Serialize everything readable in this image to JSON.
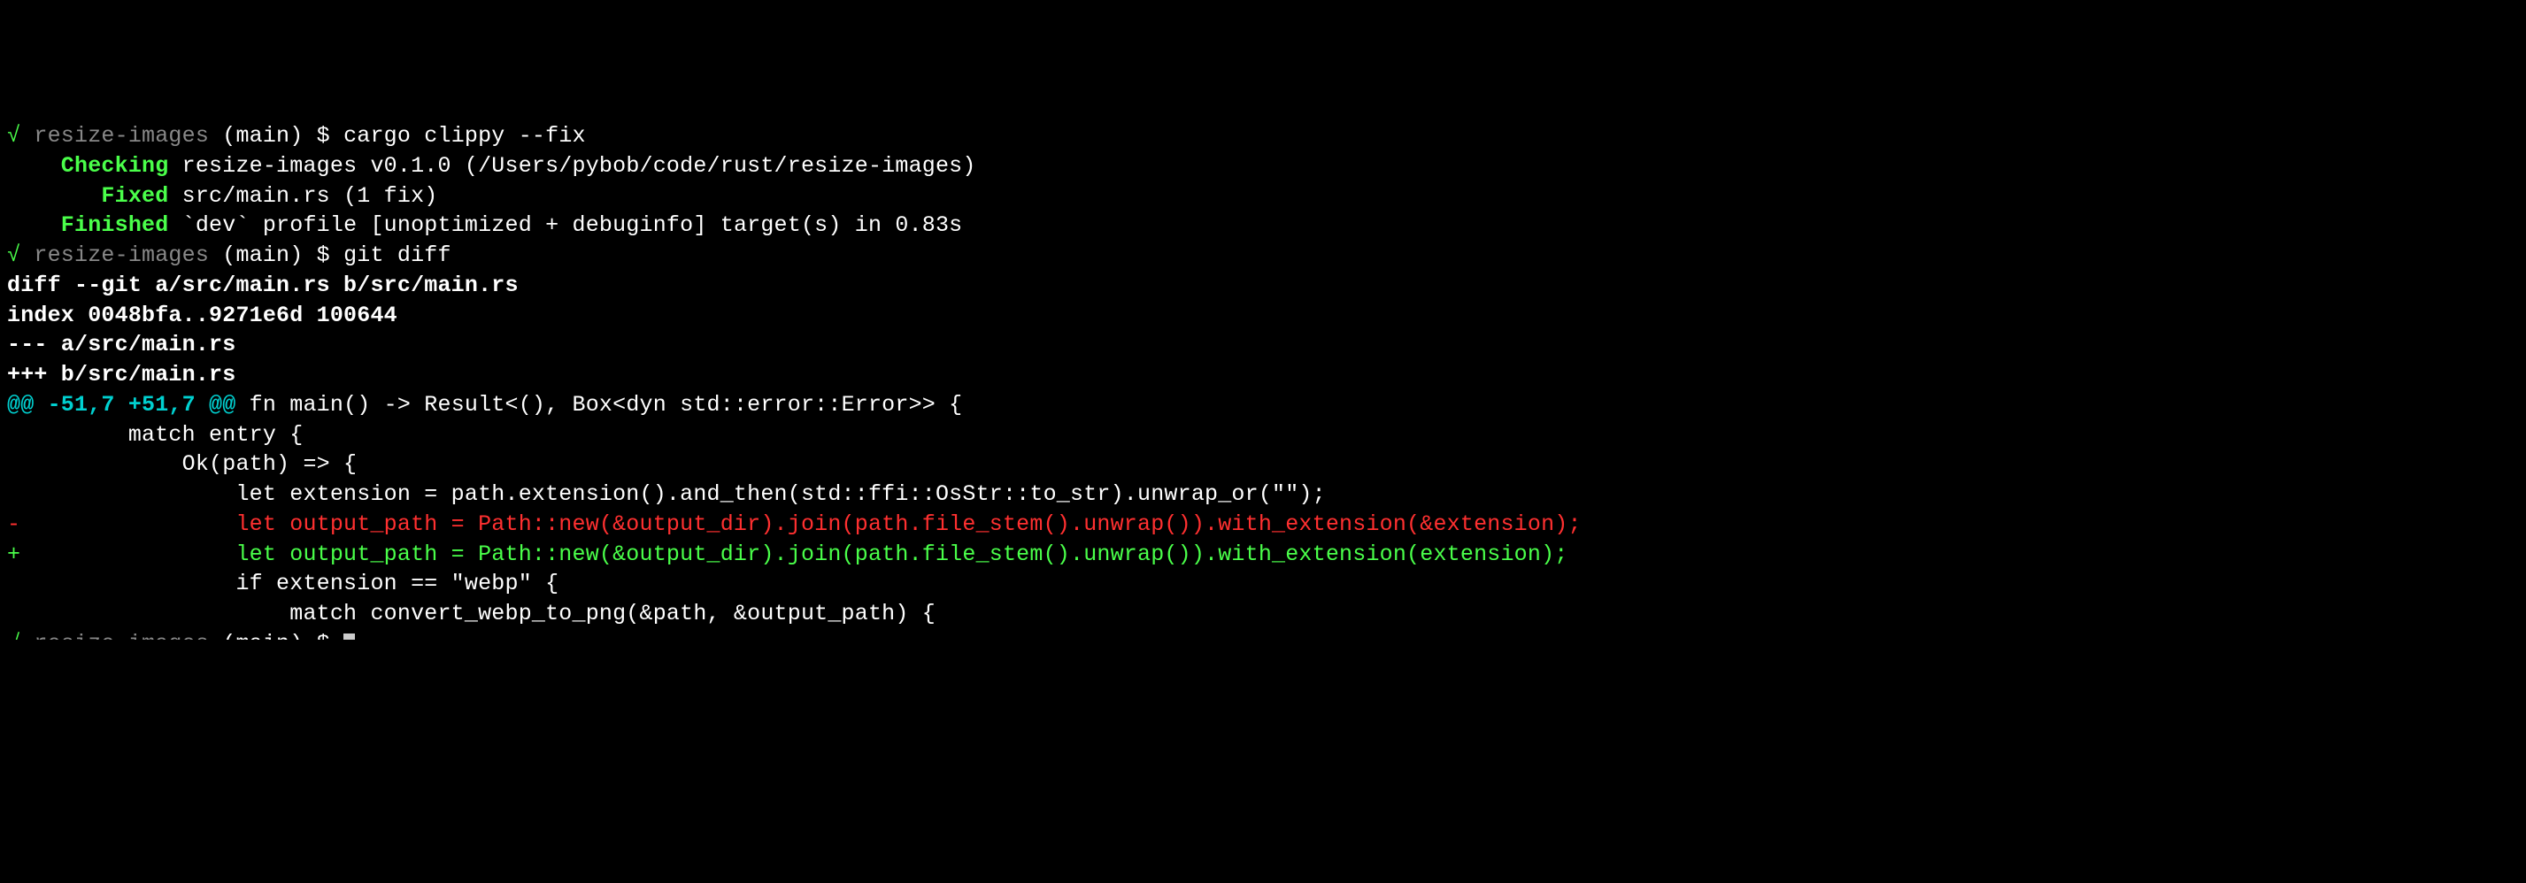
{
  "lines": [
    {
      "segments": [
        {
          "cls": "green",
          "text": "√ "
        },
        {
          "cls": "gray",
          "text": "resize-images "
        },
        {
          "cls": "white",
          "text": "(main) $ "
        },
        {
          "cls": "white",
          "text": "cargo clippy --fix"
        }
      ]
    },
    {
      "segments": [
        {
          "cls": "green-bold",
          "text": "    Checking "
        },
        {
          "cls": "white",
          "text": "resize-images v0.1.0 (/Users/pybob/code/rust/resize-images)"
        }
      ]
    },
    {
      "segments": [
        {
          "cls": "green-bold",
          "text": "       Fixed "
        },
        {
          "cls": "white",
          "text": "src/main.rs (1 fix)"
        }
      ]
    },
    {
      "segments": [
        {
          "cls": "green-bold",
          "text": "    Finished "
        },
        {
          "cls": "white",
          "text": "`dev` profile [unoptimized + debuginfo] target(s) in 0.83s"
        }
      ]
    },
    {
      "segments": [
        {
          "cls": "green",
          "text": "√ "
        },
        {
          "cls": "gray",
          "text": "resize-images "
        },
        {
          "cls": "white",
          "text": "(main) $ "
        },
        {
          "cls": "white",
          "text": "git diff"
        }
      ]
    },
    {
      "segments": [
        {
          "cls": "white-bold",
          "text": "diff --git a/src/main.rs b/src/main.rs"
        }
      ]
    },
    {
      "segments": [
        {
          "cls": "white-bold",
          "text": "index 0048bfa..9271e6d 100644"
        }
      ]
    },
    {
      "segments": [
        {
          "cls": "white-bold",
          "text": "--- a/src/main.rs"
        }
      ]
    },
    {
      "segments": [
        {
          "cls": "white-bold",
          "text": "+++ b/src/main.rs"
        }
      ]
    },
    {
      "segments": [
        {
          "cls": "cyan-bold",
          "text": "@@ -51,7 +51,7 @@"
        },
        {
          "cls": "white",
          "text": " fn main() -> Result<(), Box<dyn std::error::Error>> {"
        }
      ]
    },
    {
      "segments": [
        {
          "cls": "white",
          "text": "         match entry {"
        }
      ]
    },
    {
      "segments": [
        {
          "cls": "white",
          "text": "             Ok(path) => {"
        }
      ]
    },
    {
      "segments": [
        {
          "cls": "white",
          "text": "                 let extension = path.extension().and_then(std::ffi::OsStr::to_str).unwrap_or(\"\");"
        }
      ]
    },
    {
      "segments": [
        {
          "cls": "red",
          "text": "-                let output_path = Path::new(&output_dir).join(path.file_stem().unwrap()).with_extension(&extension);"
        }
      ]
    },
    {
      "segments": [
        {
          "cls": "green",
          "text": "+                let output_path = Path::new(&output_dir).join(path.file_stem().unwrap()).with_extension(extension);"
        }
      ]
    },
    {
      "segments": [
        {
          "cls": "white",
          "text": ""
        }
      ]
    },
    {
      "segments": [
        {
          "cls": "white",
          "text": "                 if extension == \"webp\" {"
        }
      ]
    },
    {
      "segments": [
        {
          "cls": "white",
          "text": "                     match convert_webp_to_png(&path, &output_path) {"
        }
      ]
    }
  ],
  "prompt_partial": {
    "segments": [
      {
        "cls": "green",
        "text": "√ "
      },
      {
        "cls": "gray",
        "text": "resize-images "
      },
      {
        "cls": "white",
        "text": "(main) $ "
      }
    ]
  }
}
